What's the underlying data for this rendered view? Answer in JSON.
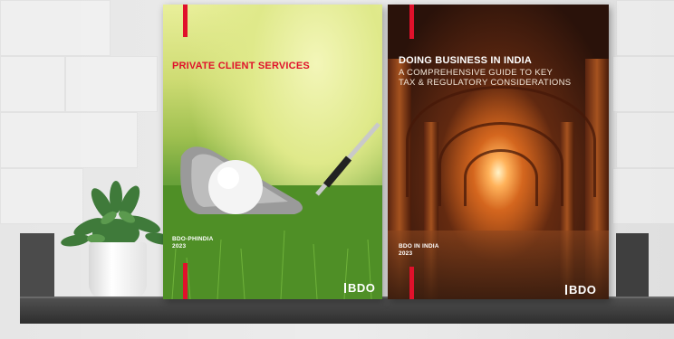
{
  "left_book": {
    "title": "PRIVATE CLIENT SERVICES",
    "footer_line1": "BDO-PHINDIA",
    "footer_line2": "2023",
    "logo": "BDO"
  },
  "right_book": {
    "title": "DOING BUSINESS IN INDIA",
    "subtitle_line1": "A COMPREHENSIVE GUIDE TO KEY",
    "subtitle_line2": "TAX & REGULATORY CONSIDERATIONS",
    "footer_line1": "BDO IN INDIA",
    "footer_line2": "2023",
    "logo": "BDO"
  },
  "colors": {
    "brand_red": "#e0112b",
    "shelf": "#3a3a3a",
    "wall": "#e6e6e6"
  }
}
